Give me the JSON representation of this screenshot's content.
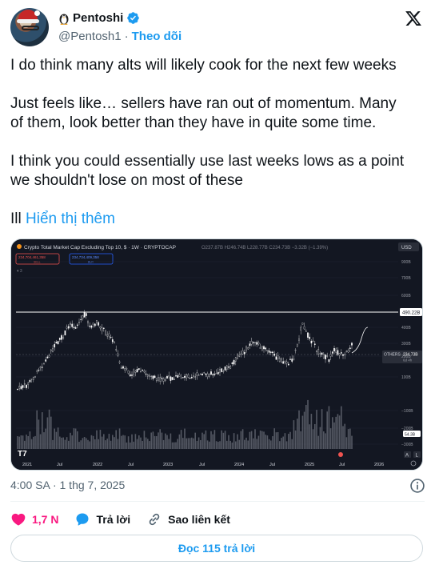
{
  "author": {
    "display_name": "Pentoshi",
    "handle": "@Pentosh1",
    "separator": "·",
    "follow_label": "Theo dõi",
    "avatar_icon": "santa-hat-avatar",
    "emoji_icon": "penguin-icon",
    "verified_icon": "verified-badge-icon",
    "verified_color": "#1d9bf0"
  },
  "platform_logo": "x-logo-icon",
  "tweet": {
    "lines": [
      "I do think many alts will likely cook for the next few weeks",
      "Just feels like… sellers have ran out of momentum. Many",
      "of them, look better than they have in quite some time.",
      "I think you could essentially use last weeks lows as a point",
      "we shouldn't lose on most of these",
      "Ill"
    ],
    "show_more": "Hiển thị thêm"
  },
  "chart": {
    "title": "Crypto Total Market Cap Excluding Top 10, $ · 1W · CRYPTOCAP",
    "ohlc": "O237.87B H246.74B L228.77B C234.73B −3.32B (−1.39%)",
    "sell_label": "234,704,461,358",
    "sell_tag": "SELL",
    "buy_label": "234,734,409,358",
    "buy_tag": "BUY",
    "indicator_count": "3",
    "currency": "USD",
    "resistance_label": "490.22B",
    "price_tag_symbol": "OTHERS",
    "price_tag_value": "234.73B",
    "price_tag_sub": "6d 4h",
    "volume_label": "54.3B",
    "y_ticks": [
      "900B",
      "700B",
      "600B",
      "400B",
      "300B",
      "200B",
      "100B",
      "−100B",
      "−200B",
      "−300B"
    ],
    "x_ticks": [
      "2021",
      "Jul",
      "2022",
      "Jul",
      "2023",
      "Jul",
      "2024",
      "Jul",
      "2025",
      "Jul",
      "2026"
    ],
    "tv_logo": "tradingview-logo-icon",
    "btn_a": "A",
    "btn_l": "L",
    "colors": {
      "bg": "#131722",
      "price": "#e8e8e8",
      "resistance": "#ffffff",
      "grid": "#1e2230",
      "sell": "#ef5350",
      "buy": "#2962ff"
    }
  },
  "meta": {
    "time": "4:00 SA",
    "separator": "·",
    "date": "1 thg 7, 2025"
  },
  "actions": {
    "like_count": "1,7 N",
    "reply_label": "Trả lời",
    "copy_link_label": "Sao liên kết"
  },
  "read_replies_label": "Đọc 115 trả lời"
}
